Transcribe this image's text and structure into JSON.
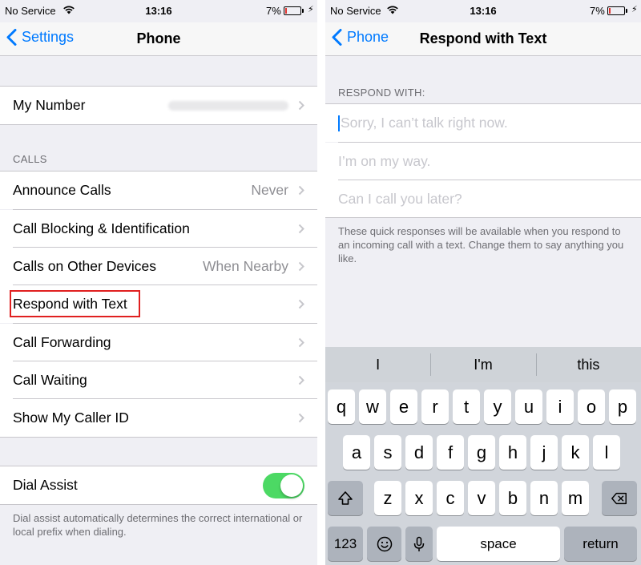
{
  "left": {
    "status": {
      "carrier": "No Service",
      "time": "13:16",
      "battery": "7%"
    },
    "nav": {
      "back": "Settings",
      "title": "Phone"
    },
    "my_number": {
      "label": "My Number"
    },
    "calls_header": "CALLS",
    "rows": [
      {
        "label": "Announce Calls",
        "value": "Never"
      },
      {
        "label": "Call Blocking & Identification",
        "value": ""
      },
      {
        "label": "Calls on Other Devices",
        "value": "When Nearby"
      },
      {
        "label": "Respond with Text",
        "value": ""
      },
      {
        "label": "Call Forwarding",
        "value": ""
      },
      {
        "label": "Call Waiting",
        "value": ""
      },
      {
        "label": "Show My Caller ID",
        "value": ""
      }
    ],
    "dial_assist": {
      "label": "Dial Assist",
      "enabled": true,
      "footer": "Dial assist automatically determines the correct international or local prefix when dialing."
    }
  },
  "right": {
    "status": {
      "carrier": "No Service",
      "time": "13:16",
      "battery": "7%"
    },
    "nav": {
      "back": "Phone",
      "title": "Respond with Text"
    },
    "section_header": "RESPOND WITH:",
    "responses": [
      "Sorry, I can’t talk right now.",
      "I’m on my way.",
      "Can I call you later?"
    ],
    "footer": "These quick responses will be available when you respond to an incoming call with a text. Change them to say anything you like.",
    "keyboard": {
      "suggestions": [
        "I",
        "I'm",
        "this"
      ],
      "row1": [
        "q",
        "w",
        "e",
        "r",
        "t",
        "y",
        "u",
        "i",
        "o",
        "p"
      ],
      "row2": [
        "a",
        "s",
        "d",
        "f",
        "g",
        "h",
        "j",
        "k",
        "l"
      ],
      "row3": [
        "z",
        "x",
        "c",
        "v",
        "b",
        "n",
        "m"
      ],
      "numbers_key": "123",
      "space_key": "space",
      "return_key": "return"
    }
  },
  "colors": {
    "accent": "#007aff",
    "highlight_box": "#e02020",
    "toggle_on": "#4cd964"
  },
  "icons": [
    "wifi-icon",
    "battery-icon",
    "charging-bolt-icon",
    "chevron-left-icon",
    "chevron-right-icon",
    "shift-icon",
    "delete-icon",
    "emoji-icon",
    "microphone-icon"
  ]
}
